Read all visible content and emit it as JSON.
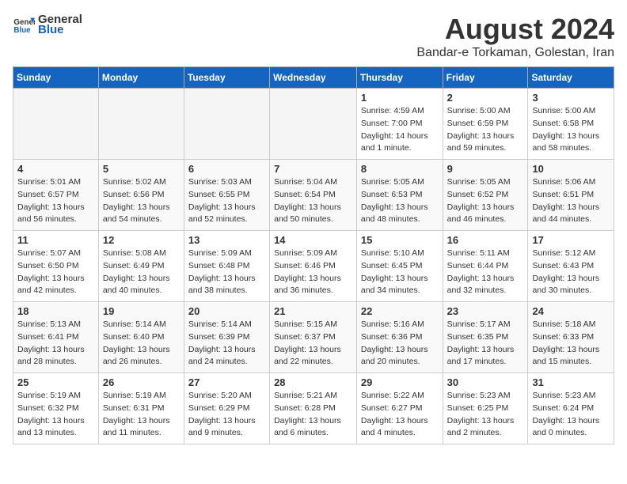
{
  "logo": {
    "general": "General",
    "blue": "Blue"
  },
  "title": "August 2024",
  "location": "Bandar-e Torkaman, Golestan, Iran",
  "headers": [
    "Sunday",
    "Monday",
    "Tuesday",
    "Wednesday",
    "Thursday",
    "Friday",
    "Saturday"
  ],
  "weeks": [
    [
      {
        "day": "",
        "info": ""
      },
      {
        "day": "",
        "info": ""
      },
      {
        "day": "",
        "info": ""
      },
      {
        "day": "",
        "info": ""
      },
      {
        "day": "1",
        "info": "Sunrise: 4:59 AM\nSunset: 7:00 PM\nDaylight: 14 hours\nand 1 minute."
      },
      {
        "day": "2",
        "info": "Sunrise: 5:00 AM\nSunset: 6:59 PM\nDaylight: 13 hours\nand 59 minutes."
      },
      {
        "day": "3",
        "info": "Sunrise: 5:00 AM\nSunset: 6:58 PM\nDaylight: 13 hours\nand 58 minutes."
      }
    ],
    [
      {
        "day": "4",
        "info": "Sunrise: 5:01 AM\nSunset: 6:57 PM\nDaylight: 13 hours\nand 56 minutes."
      },
      {
        "day": "5",
        "info": "Sunrise: 5:02 AM\nSunset: 6:56 PM\nDaylight: 13 hours\nand 54 minutes."
      },
      {
        "day": "6",
        "info": "Sunrise: 5:03 AM\nSunset: 6:55 PM\nDaylight: 13 hours\nand 52 minutes."
      },
      {
        "day": "7",
        "info": "Sunrise: 5:04 AM\nSunset: 6:54 PM\nDaylight: 13 hours\nand 50 minutes."
      },
      {
        "day": "8",
        "info": "Sunrise: 5:05 AM\nSunset: 6:53 PM\nDaylight: 13 hours\nand 48 minutes."
      },
      {
        "day": "9",
        "info": "Sunrise: 5:05 AM\nSunset: 6:52 PM\nDaylight: 13 hours\nand 46 minutes."
      },
      {
        "day": "10",
        "info": "Sunrise: 5:06 AM\nSunset: 6:51 PM\nDaylight: 13 hours\nand 44 minutes."
      }
    ],
    [
      {
        "day": "11",
        "info": "Sunrise: 5:07 AM\nSunset: 6:50 PM\nDaylight: 13 hours\nand 42 minutes."
      },
      {
        "day": "12",
        "info": "Sunrise: 5:08 AM\nSunset: 6:49 PM\nDaylight: 13 hours\nand 40 minutes."
      },
      {
        "day": "13",
        "info": "Sunrise: 5:09 AM\nSunset: 6:48 PM\nDaylight: 13 hours\nand 38 minutes."
      },
      {
        "day": "14",
        "info": "Sunrise: 5:09 AM\nSunset: 6:46 PM\nDaylight: 13 hours\nand 36 minutes."
      },
      {
        "day": "15",
        "info": "Sunrise: 5:10 AM\nSunset: 6:45 PM\nDaylight: 13 hours\nand 34 minutes."
      },
      {
        "day": "16",
        "info": "Sunrise: 5:11 AM\nSunset: 6:44 PM\nDaylight: 13 hours\nand 32 minutes."
      },
      {
        "day": "17",
        "info": "Sunrise: 5:12 AM\nSunset: 6:43 PM\nDaylight: 13 hours\nand 30 minutes."
      }
    ],
    [
      {
        "day": "18",
        "info": "Sunrise: 5:13 AM\nSunset: 6:41 PM\nDaylight: 13 hours\nand 28 minutes."
      },
      {
        "day": "19",
        "info": "Sunrise: 5:14 AM\nSunset: 6:40 PM\nDaylight: 13 hours\nand 26 minutes."
      },
      {
        "day": "20",
        "info": "Sunrise: 5:14 AM\nSunset: 6:39 PM\nDaylight: 13 hours\nand 24 minutes."
      },
      {
        "day": "21",
        "info": "Sunrise: 5:15 AM\nSunset: 6:37 PM\nDaylight: 13 hours\nand 22 minutes."
      },
      {
        "day": "22",
        "info": "Sunrise: 5:16 AM\nSunset: 6:36 PM\nDaylight: 13 hours\nand 20 minutes."
      },
      {
        "day": "23",
        "info": "Sunrise: 5:17 AM\nSunset: 6:35 PM\nDaylight: 13 hours\nand 17 minutes."
      },
      {
        "day": "24",
        "info": "Sunrise: 5:18 AM\nSunset: 6:33 PM\nDaylight: 13 hours\nand 15 minutes."
      }
    ],
    [
      {
        "day": "25",
        "info": "Sunrise: 5:19 AM\nSunset: 6:32 PM\nDaylight: 13 hours\nand 13 minutes."
      },
      {
        "day": "26",
        "info": "Sunrise: 5:19 AM\nSunset: 6:31 PM\nDaylight: 13 hours\nand 11 minutes."
      },
      {
        "day": "27",
        "info": "Sunrise: 5:20 AM\nSunset: 6:29 PM\nDaylight: 13 hours\nand 9 minutes."
      },
      {
        "day": "28",
        "info": "Sunrise: 5:21 AM\nSunset: 6:28 PM\nDaylight: 13 hours\nand 6 minutes."
      },
      {
        "day": "29",
        "info": "Sunrise: 5:22 AM\nSunset: 6:27 PM\nDaylight: 13 hours\nand 4 minutes."
      },
      {
        "day": "30",
        "info": "Sunrise: 5:23 AM\nSunset: 6:25 PM\nDaylight: 13 hours\nand 2 minutes."
      },
      {
        "day": "31",
        "info": "Sunrise: 5:23 AM\nSunset: 6:24 PM\nDaylight: 13 hours\nand 0 minutes."
      }
    ]
  ]
}
